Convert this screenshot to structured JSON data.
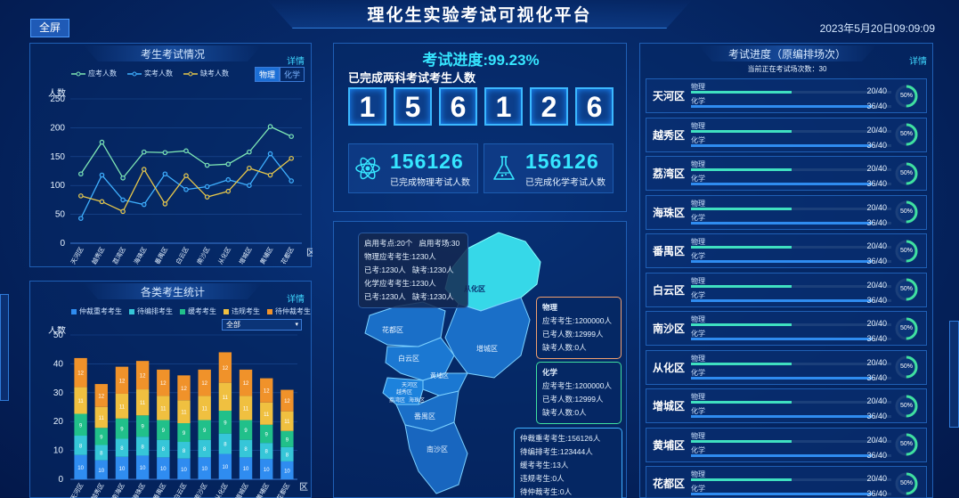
{
  "header": {
    "title": "理化生实验考试可视化平台",
    "fullscreen": "全屏",
    "datetime": "2023年5月20日09:09:09"
  },
  "exam_situation": {
    "title": "考生考试情况",
    "detail": "详情",
    "legend": [
      "应考人数",
      "实考人数",
      "缺考人数"
    ],
    "toggle": [
      "物理",
      "化学"
    ],
    "ylabel": "人数",
    "xlabel": "区"
  },
  "category_stats": {
    "title": "各类考生统计",
    "detail": "详情",
    "select": "全部",
    "legend": [
      "仲裁重考考生",
      "待编排考生",
      "缓考考生",
      "违规考生",
      "待仲裁考生"
    ],
    "ylabel": "人数",
    "xlabel": "区"
  },
  "progress": {
    "title": "考试进度:99.23%",
    "completed_label": "已完成两科考试考生人数",
    "digits": [
      "1",
      "5",
      "6",
      "1",
      "2",
      "6"
    ],
    "physics_num": "156126",
    "physics_label": "已完成物理考试人数",
    "chem_num": "156126",
    "chem_label": "已完成化学考试人数"
  },
  "map": {
    "tooltip": [
      "启用考点:20个",
      "启用考场:30",
      "物理应考考生:1230人",
      "已考:1230人",
      "缺考:1230人",
      "化学应考考生:1230人",
      "已考:1230人",
      "缺考:1230人"
    ],
    "labels": [
      "从化区",
      "花都区",
      "白云区",
      "增城区",
      "黄埔区",
      "天河区",
      "越秀区",
      "荔湾区",
      "海珠区",
      "番禺区",
      "南沙区"
    ],
    "physics_box": {
      "title": "物理",
      "lines": [
        "应考考生:1200000人",
        "已考人数:12999人",
        "缺考人数:0人"
      ]
    },
    "chem_box": {
      "title": "化学",
      "lines": [
        "应考考生:1200000人",
        "已考人数:12999人",
        "缺考人数:0人"
      ]
    },
    "other_box": [
      "仲裁重考考生:156126人",
      "待编排考生:123444人",
      "缓考考生:13人",
      "违规考生:0人",
      "待仲裁考生:0人"
    ]
  },
  "exam_progress": {
    "title": "考试进度（原编排场次）",
    "detail": "详情",
    "subtitle": "当前正在考试场次数：30",
    "rows": [
      {
        "name": "天河区",
        "phys": "物理",
        "chem": "化学",
        "phys_val": "20/40",
        "chem_val": "36/40",
        "phys_frac": 0.5,
        "chem_frac": 0.9,
        "pct": "50%",
        "pct_frac": 0.5
      },
      {
        "name": "越秀区",
        "phys": "物理",
        "chem": "化学",
        "phys_val": "20/40",
        "chem_val": "36/40",
        "phys_frac": 0.5,
        "chem_frac": 0.9,
        "pct": "50%",
        "pct_frac": 0.5
      },
      {
        "name": "荔湾区",
        "phys": "物理",
        "chem": "化学",
        "phys_val": "20/40",
        "chem_val": "36/40",
        "phys_frac": 0.5,
        "chem_frac": 0.9,
        "pct": "50%",
        "pct_frac": 0.5
      },
      {
        "name": "海珠区",
        "phys": "物理",
        "chem": "化学",
        "phys_val": "20/40",
        "chem_val": "36/40",
        "phys_frac": 0.5,
        "chem_frac": 0.9,
        "pct": "50%",
        "pct_frac": 0.5
      },
      {
        "name": "番禺区",
        "phys": "物理",
        "chem": "化学",
        "phys_val": "20/40",
        "chem_val": "36/40",
        "phys_frac": 0.5,
        "chem_frac": 0.9,
        "pct": "50%",
        "pct_frac": 0.5
      },
      {
        "name": "白云区",
        "phys": "物理",
        "chem": "化学",
        "phys_val": "20/40",
        "chem_val": "36/40",
        "phys_frac": 0.5,
        "chem_frac": 0.9,
        "pct": "50%",
        "pct_frac": 0.5
      },
      {
        "name": "南沙区",
        "phys": "物理",
        "chem": "化学",
        "phys_val": "20/40",
        "chem_val": "36/40",
        "phys_frac": 0.5,
        "chem_frac": 0.9,
        "pct": "50%",
        "pct_frac": 0.5
      },
      {
        "name": "从化区",
        "phys": "物理",
        "chem": "化学",
        "phys_val": "20/40",
        "chem_val": "36/40",
        "phys_frac": 0.5,
        "chem_frac": 0.9,
        "pct": "50%",
        "pct_frac": 0.5
      },
      {
        "name": "增城区",
        "phys": "物理",
        "chem": "化学",
        "phys_val": "20/40",
        "chem_val": "36/40",
        "phys_frac": 0.5,
        "chem_frac": 0.9,
        "pct": "50%",
        "pct_frac": 0.5
      },
      {
        "name": "黄埔区",
        "phys": "物理",
        "chem": "化学",
        "phys_val": "20/40",
        "chem_val": "36/40",
        "phys_frac": 0.5,
        "chem_frac": 0.9,
        "pct": "50%",
        "pct_frac": 0.5
      },
      {
        "name": "花都区",
        "phys": "物理",
        "chem": "化学",
        "phys_val": "20/40",
        "chem_val": "36/40",
        "phys_frac": 0.5,
        "chem_frac": 0.9,
        "pct": "50%",
        "pct_frac": 0.5
      }
    ]
  },
  "colors": {
    "green": "#7ee6b4",
    "blue": "#3fb0ff",
    "yellow": "#e8c84a",
    "cyan": "#36e6ff",
    "accent": "#1c6fd6"
  },
  "chart_data": [
    {
      "type": "line",
      "title": "考生考试情况",
      "ylabel": "人数",
      "xlabel": "区",
      "ylim": [
        0,
        250
      ],
      "yticks": [
        0,
        50,
        100,
        150,
        200,
        250
      ],
      "categories": [
        "天河区",
        "越秀区",
        "荔湾区",
        "海珠区",
        "番禺区",
        "白云区",
        "南沙区",
        "从化区",
        "增城区",
        "黄埔区",
        "花都区"
      ],
      "series": [
        {
          "name": "应考人数",
          "color": "#7ee6b4",
          "values": [
            120,
            175,
            113,
            158,
            157,
            160,
            135,
            137,
            158,
            202,
            185
          ]
        },
        {
          "name": "实考人数",
          "color": "#3fb0ff",
          "values": [
            43,
            118,
            75,
            67,
            120,
            93,
            98,
            110,
            100,
            155,
            108
          ]
        },
        {
          "name": "缺考人数",
          "color": "#e8c84a",
          "values": [
            82,
            72,
            55,
            128,
            68,
            117,
            80,
            90,
            130,
            118,
            147
          ]
        }
      ]
    },
    {
      "type": "bar",
      "title": "各类考生统计",
      "ylabel": "人数",
      "xlabel": "区",
      "ylim": [
        0,
        50
      ],
      "yticks": [
        0,
        10,
        20,
        30,
        40,
        50
      ],
      "categories": [
        "天河区",
        "越秀区",
        "南海区",
        "海珠区",
        "番禺区",
        "白云区",
        "南沙区",
        "从化区",
        "增城区",
        "黄埔区",
        "花都区"
      ],
      "series": [
        {
          "name": "仲裁重考考生",
          "color": "#2f8cf0",
          "values": [
            10,
            10,
            10,
            10,
            10,
            10,
            10,
            10,
            10,
            10,
            10
          ]
        },
        {
          "name": "待编排考生",
          "color": "#36c6d8",
          "values": [
            8,
            8,
            8,
            8,
            8,
            8,
            8,
            8,
            8,
            8,
            8
          ]
        },
        {
          "name": "缓考考生",
          "color": "#21c08a",
          "values": [
            9,
            9,
            9,
            9,
            9,
            9,
            9,
            9,
            9,
            9,
            9
          ]
        },
        {
          "name": "违规考生",
          "color": "#f0c040",
          "values": [
            11,
            11,
            11,
            11,
            11,
            11,
            11,
            11,
            11,
            11,
            11
          ]
        },
        {
          "name": "待仲裁考生",
          "color": "#f0922a",
          "values": [
            12,
            12,
            12,
            12,
            12,
            12,
            12,
            12,
            12,
            12,
            12
          ]
        }
      ],
      "totals": [
        42,
        33,
        39,
        41,
        38,
        36,
        38,
        44,
        38,
        35,
        31
      ]
    }
  ]
}
